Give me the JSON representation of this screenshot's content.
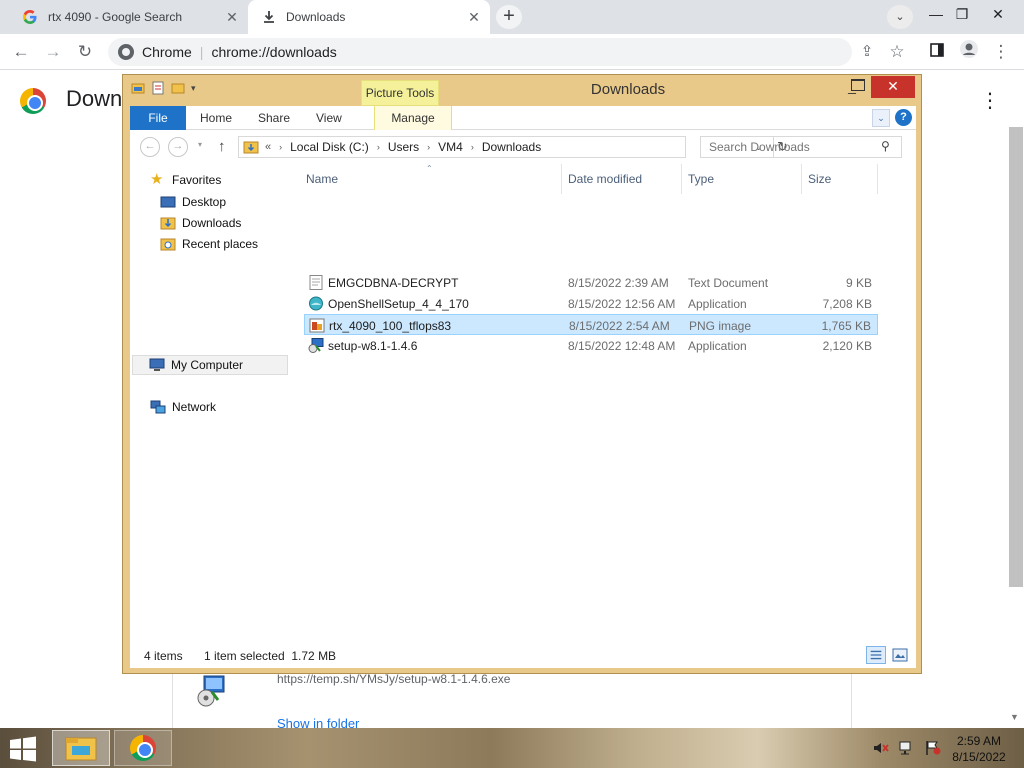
{
  "chrome": {
    "tabs": [
      {
        "title": "rtx 4090 - Google Search",
        "icon": "google-g-icon"
      },
      {
        "title": "Downloads",
        "icon": "download-icon"
      }
    ],
    "omnibox": {
      "site": "Chrome",
      "separator": "|",
      "url": "chrome://downloads"
    },
    "page": {
      "heading": "Down"
    },
    "download_item": {
      "url": "https://temp.sh/YMsJy/setup-w8.1-1.4.6.exe",
      "show_in_folder": "Show in folder"
    }
  },
  "explorer": {
    "title": "Downloads",
    "contextual_tab_group": "Picture Tools",
    "ribbon_tabs": {
      "file": "File",
      "home": "Home",
      "share": "Share",
      "view": "View",
      "manage": "Manage"
    },
    "breadcrumb": {
      "prefix": "«",
      "items": [
        "Local Disk (C:)",
        "Users",
        "VM4",
        "Downloads"
      ]
    },
    "search": {
      "placeholder": "Search Downloads"
    },
    "nav_pane": {
      "favorites": "Favorites",
      "favorite_items": [
        "Desktop",
        "Downloads",
        "Recent places"
      ],
      "my_computer": "My Computer",
      "network": "Network"
    },
    "columns": {
      "name": "Name",
      "date": "Date modified",
      "type": "Type",
      "size": "Size"
    },
    "files": [
      {
        "name": "EMGCDBNA-DECRYPT",
        "date": "8/15/2022 2:39 AM",
        "type": "Text Document",
        "size": "9 KB",
        "icon": "text-document-icon"
      },
      {
        "name": "OpenShellSetup_4_4_170",
        "date": "8/15/2022 12:56 AM",
        "type": "Application",
        "size": "7,208 KB",
        "icon": "openshell-icon"
      },
      {
        "name": "rtx_4090_100_tflops83",
        "date": "8/15/2022 2:54 AM",
        "type": "PNG image",
        "size": "1,765 KB",
        "icon": "png-image-icon",
        "selected": true
      },
      {
        "name": "setup-w8.1-1.4.6",
        "date": "8/15/2022 12:48 AM",
        "type": "Application",
        "size": "2,120 KB",
        "icon": "installer-icon"
      }
    ],
    "status": {
      "count": "4 items",
      "selected": "1 item selected  1.72 MB"
    }
  },
  "taskbar": {
    "clock_time": "2:59 AM",
    "clock_date": "8/15/2022"
  },
  "colors": {
    "explorer_frame": "#e9c98a",
    "ribbon_file": "#1e73c9",
    "close_button": "#c7322b",
    "selection": "#cce8ff",
    "picture_tools": "#f5f19a"
  }
}
